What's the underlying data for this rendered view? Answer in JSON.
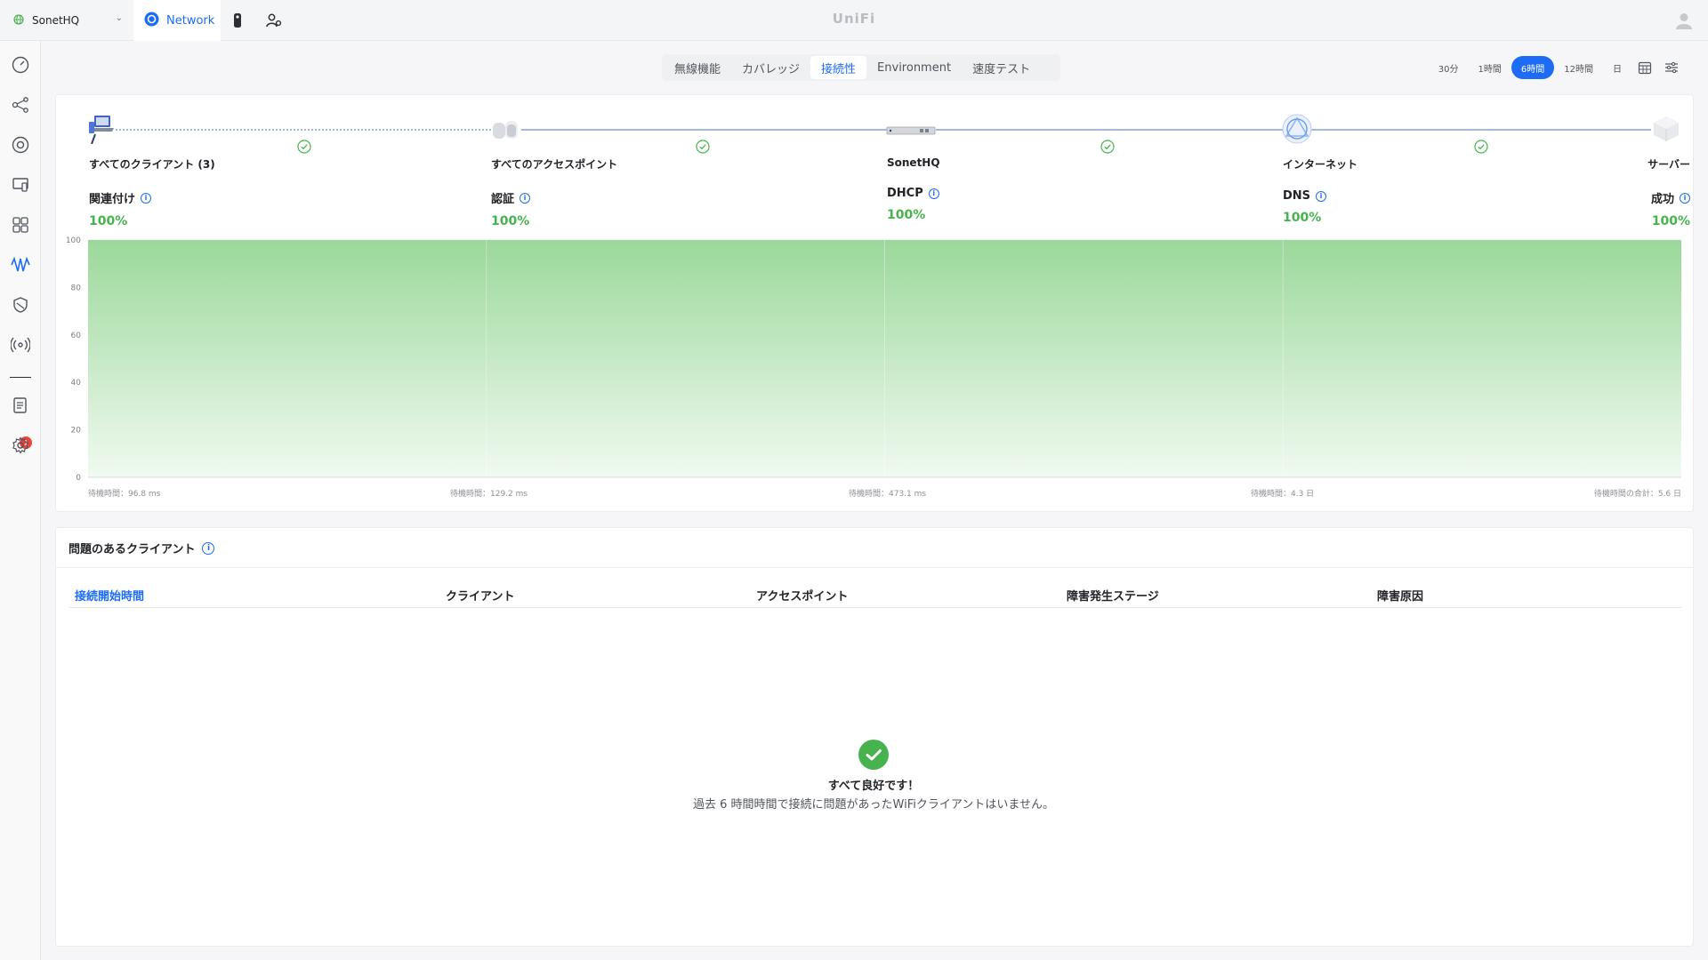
{
  "topbar": {
    "site_name": "SonetHQ",
    "app_tab": "Network",
    "brand": "UniFi"
  },
  "tabs": [
    {
      "label": "無線機能",
      "active": false
    },
    {
      "label": "カバレッジ",
      "active": false
    },
    {
      "label": "接続性",
      "active": true
    },
    {
      "label": "Environment",
      "active": false
    },
    {
      "label": "速度テスト",
      "active": false
    }
  ],
  "time_range": {
    "options": [
      "30分",
      "1時間",
      "6時間",
      "12時間",
      "日"
    ],
    "selected": "6時間"
  },
  "stages": [
    {
      "name": "すべてのクライアント (3)",
      "metric": "関連付け",
      "value": "100%"
    },
    {
      "name": "すべてのアクセスポイント",
      "metric": "認証",
      "value": "100%"
    },
    {
      "name": "SonetHQ",
      "metric": "DHCP",
      "value": "100%"
    },
    {
      "name": "インターネット",
      "metric": "DNS",
      "value": "100%"
    },
    {
      "name": "サーバー",
      "metric": "成功",
      "value": "100%"
    }
  ],
  "latency_labels": [
    "待機時間：96.8 ms",
    "待機時間：129.2 ms",
    "待機時間：473.1 ms",
    "待機時間：4.3 日",
    "待機時間の合計：5.6 日"
  ],
  "chart_data": {
    "type": "area",
    "title": "",
    "xlabel": "",
    "ylabel": "",
    "ylim": [
      0,
      100
    ],
    "yticks": [
      "100",
      "80",
      "60",
      "40",
      "20",
      "0"
    ],
    "series": [
      {
        "values": [
          100,
          100,
          100,
          100,
          100
        ]
      }
    ],
    "grid": true,
    "colors": {
      "fill_top": "#9bd89b",
      "fill_bottom": "#f1faf1"
    }
  },
  "issues_panel": {
    "title": "問題のあるクライアント",
    "columns": [
      "接続開始時間",
      "クライアント",
      "アクセスポイント",
      "障害発生ステージ",
      "障害原因"
    ],
    "empty_title": "すべて良好です！",
    "empty_desc": "過去 6 時間時間で接続に問題があったWiFiクライアントはいません。"
  },
  "notifications": {
    "count": "1"
  },
  "colors": {
    "accent": "#1d6cf5",
    "success": "#47b34e"
  }
}
